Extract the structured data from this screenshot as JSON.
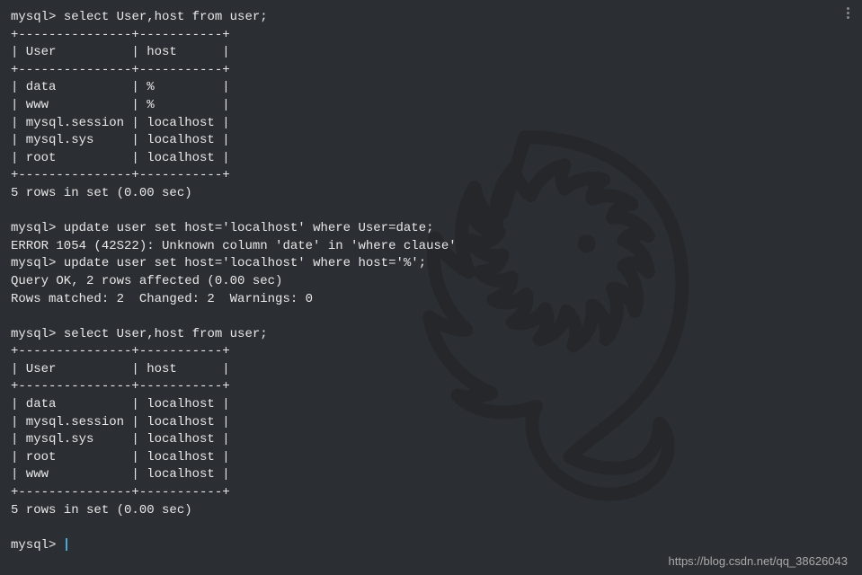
{
  "prompt": "mysql>",
  "queries": {
    "select1": "select User,host from user;",
    "update1": "update user set host='localhost' where User=date;",
    "update2": "update user set host='localhost' where host='%';",
    "select2": "select User,host from user;"
  },
  "table1": {
    "divider": "+---------------+-----------+",
    "header": "| User          | host      |",
    "rows": [
      "| data          | %         |",
      "| www           | %         |",
      "| mysql.session | localhost |",
      "| mysql.sys     | localhost |",
      "| root          | localhost |"
    ],
    "summary": "5 rows in set (0.00 sec)"
  },
  "error": "ERROR 1054 (42S22): Unknown column 'date' in 'where clause'",
  "update_result": {
    "line1": "Query OK, 2 rows affected (0.00 sec)",
    "line2": "Rows matched: 2  Changed: 2  Warnings: 0"
  },
  "table2": {
    "divider": "+---------------+-----------+",
    "header": "| User          | host      |",
    "rows": [
      "| data          | localhost |",
      "| mysql.session | localhost |",
      "| mysql.sys     | localhost |",
      "| root          | localhost |",
      "| www           | localhost |"
    ],
    "summary": "5 rows in set (0.00 sec)"
  },
  "watermark": "https://blog.csdn.net/qq_38626043"
}
